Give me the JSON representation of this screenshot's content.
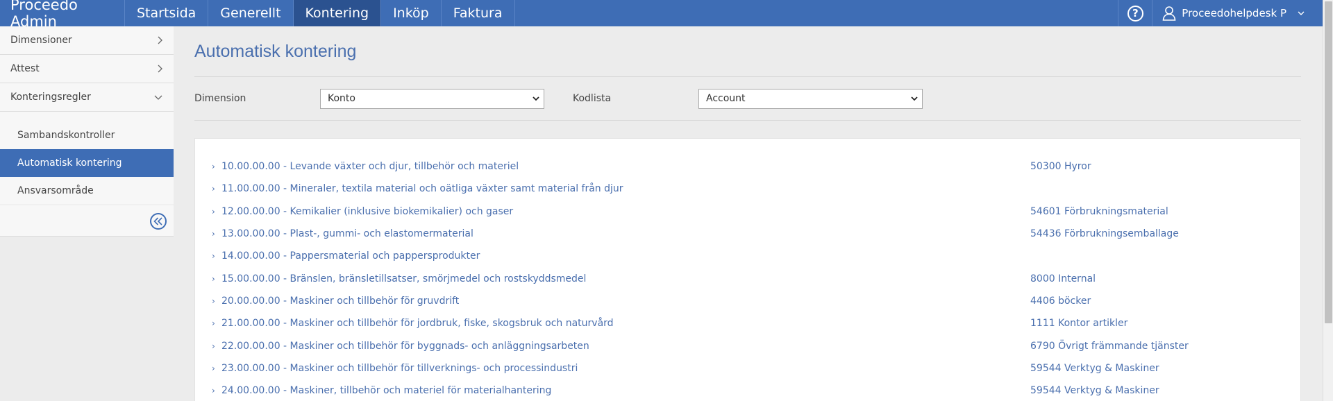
{
  "topbar": {
    "brand": "Proceedo Admin",
    "nav": [
      {
        "label": "Startsida",
        "active": false
      },
      {
        "label": "Generellt",
        "active": false
      },
      {
        "label": "Kontering",
        "active": true
      },
      {
        "label": "Inköp",
        "active": false
      },
      {
        "label": "Faktura",
        "active": false
      }
    ],
    "help_icon": "?",
    "user_name": "Proceedohelpdesk P"
  },
  "sidebar": {
    "items": [
      {
        "label": "Dimensioner",
        "icon": "chevron-right-icon"
      },
      {
        "label": "Attest",
        "icon": "chevron-right-icon"
      },
      {
        "label": "Konteringsregler",
        "icon": "chevron-down-icon"
      }
    ],
    "subitems": [
      {
        "label": "Sambandskontroller",
        "active": false
      },
      {
        "label": "Automatisk kontering",
        "active": true
      },
      {
        "label": "Ansvarsområde",
        "active": false
      }
    ]
  },
  "main": {
    "title": "Automatisk kontering",
    "filters": {
      "dimension_label": "Dimension",
      "dimension_value": "Konto",
      "kodlista_label": "Kodlista",
      "kodlista_value": "Account"
    },
    "rows": [
      {
        "category": "10.00.00.00 - Levande växter och djur, tillbehör och materiel",
        "account": "50300 Hyror"
      },
      {
        "category": "11.00.00.00 - Mineraler, textila material och oätliga växter samt material från djur",
        "account": ""
      },
      {
        "category": "12.00.00.00 - Kemikalier (inklusive biokemikalier) och gaser",
        "account": "54601 Förbrukningsmaterial"
      },
      {
        "category": "13.00.00.00 - Plast-, gummi- och elastomermaterial",
        "account": "54436 Förbrukningsemballage"
      },
      {
        "category": "14.00.00.00 - Pappersmaterial och pappersprodukter",
        "account": ""
      },
      {
        "category": "15.00.00.00 - Bränslen, bränsletillsatser, smörjmedel och rostskyddsmedel",
        "account": "8000 Internal"
      },
      {
        "category": "20.00.00.00 - Maskiner och tillbehör för gruvdrift",
        "account": "4406 böcker"
      },
      {
        "category": "21.00.00.00 - Maskiner och tillbehör för jordbruk, fiske, skogsbruk och naturvård",
        "account": "1111 Kontor artikler"
      },
      {
        "category": "22.00.00.00 - Maskiner och tillbehör för byggnads- och anläggningsarbeten",
        "account": "6790 Övrigt främmande tjänster"
      },
      {
        "category": "23.00.00.00 - Maskiner och tillbehör för tillverknings- och processindustri",
        "account": "59544 Verktyg & Maskiner"
      },
      {
        "category": "24.00.00.00 - Maskiner, tillbehör och materiel för materialhantering",
        "account": "59544 Verktyg & Maskiner"
      }
    ]
  },
  "colors": {
    "nav_bg": "#3e6db5",
    "nav_active": "#2b5290",
    "link": "#4a6fae"
  }
}
